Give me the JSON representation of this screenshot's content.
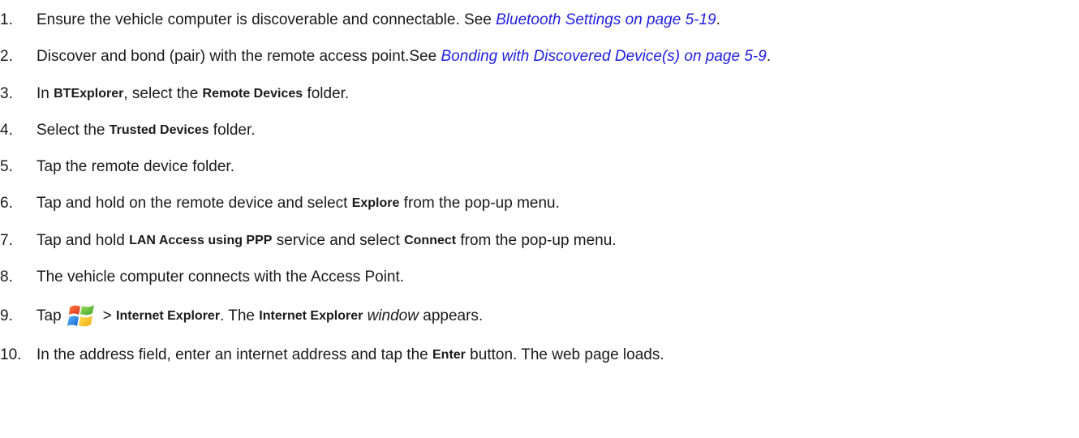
{
  "steps": [
    {
      "number": "1.",
      "text_before": "Ensure the vehicle computer is discoverable and connectable. See ",
      "link": "Bluetooth Settings on page 5-19",
      "text_after": "."
    },
    {
      "number": "2.",
      "text_before": "Discover and bond (pair) with the remote access point.See ",
      "link": "Bonding with Discovered Device(s) on page 5-9",
      "text_after": "."
    },
    {
      "number": "3.",
      "t1": "In ",
      "b1": "BTExplorer",
      "t2": ", select the ",
      "b2": "Remote Devices",
      "t3": " folder."
    },
    {
      "number": "4.",
      "t1": "Select the ",
      "b1": "Trusted Devices",
      "t2": " folder."
    },
    {
      "number": "5.",
      "t1": "Tap the remote device folder."
    },
    {
      "number": "6.",
      "t1": "Tap and hold on the remote device and select ",
      "b1": "Explore",
      "t2": " from the pop-up menu."
    },
    {
      "number": "7.",
      "t1": "Tap and hold ",
      "b1": "LAN Access using PPP",
      "t2": " service and select ",
      "b2": "Connect",
      "t3": " from the pop-up menu."
    },
    {
      "number": "8.",
      "t1": "The vehicle computer connects with the Access Point."
    },
    {
      "number": "9.",
      "t1": "Tap",
      "icon": "windows-start-logo-icon",
      "t2": "> ",
      "b1": "Internet Explorer",
      "t3": ". The ",
      "b2": "Internet Explorer",
      "t4": " ",
      "i1": "window",
      "t5": " appears."
    },
    {
      "number": "10.",
      "t1": "In the address field, enter an internet address and tap the ",
      "b1": "Enter",
      "t2": " button. The web page loads."
    }
  ],
  "colors": {
    "text": "#1a1a1a",
    "link": "#1f1fe0",
    "logo_red": "#e8491d",
    "logo_green": "#6cc04a",
    "logo_blue": "#1e90e8",
    "logo_yellow": "#f7c31a"
  }
}
